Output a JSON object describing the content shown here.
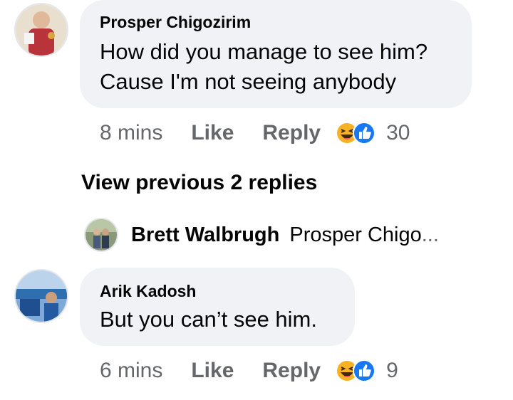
{
  "comments": [
    {
      "author": "Prosper Chigozirim",
      "text_lines": [
        "How did you manage to see him?",
        "Cause I'm not seeing anybody"
      ],
      "time": "8 mins",
      "like_label": "Like",
      "reply_label": "Reply",
      "reaction_count": "30",
      "reactions": [
        "haha-icon",
        "like-icon"
      ]
    },
    {
      "author": "Arik Kadosh",
      "text_lines": [
        "But you can’t see him."
      ],
      "time": "6 mins",
      "like_label": "Like",
      "reply_label": "Reply",
      "reaction_count": "9",
      "reactions": [
        "haha-icon",
        "like-icon"
      ]
    }
  ],
  "view_previous": "View previous 2 replies",
  "collapsed_reply": {
    "author": "Brett Walbrugh",
    "preview": "Prosper Chigo",
    "ellipsis": "..."
  },
  "colors": {
    "bubble": "#f0f2f5",
    "meta_text": "#65676b",
    "like_blue": "#1877f2",
    "haha_yellow": "#f7b125"
  }
}
